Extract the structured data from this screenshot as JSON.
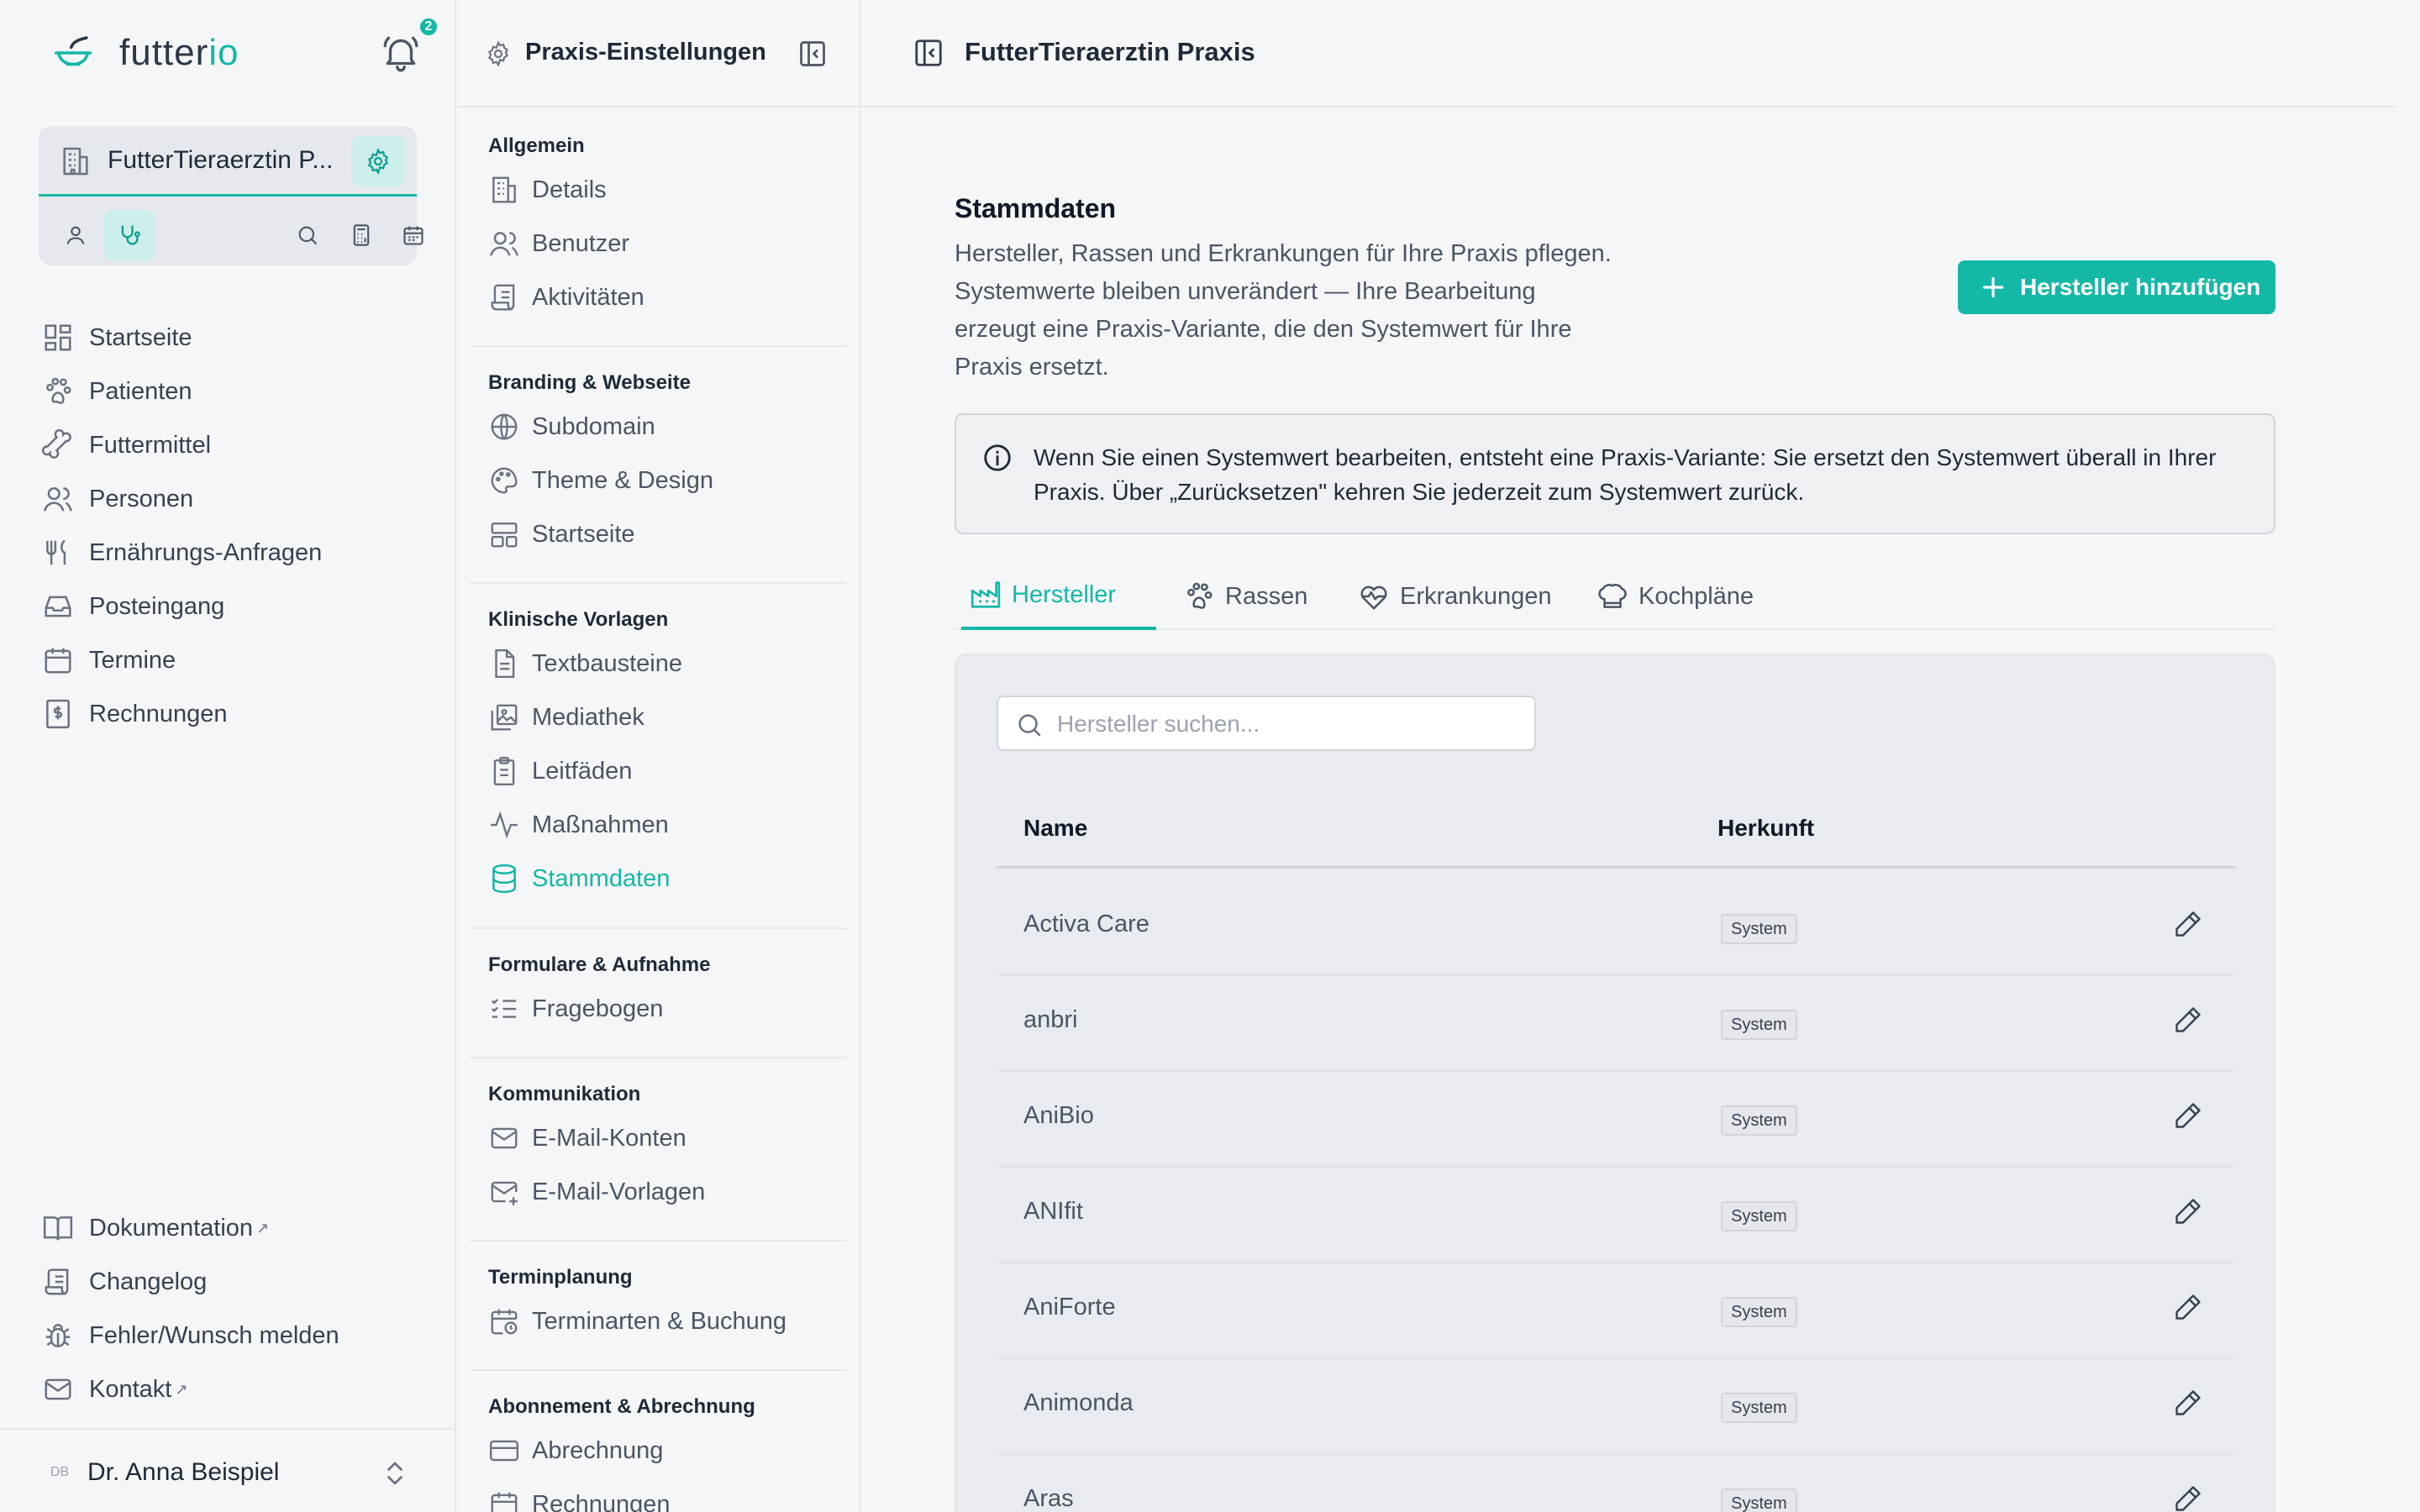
{
  "brand": {
    "logo_text_main": "futter",
    "logo_text_accent": "io",
    "notification_count": "2",
    "accent": "#14b8a6"
  },
  "practice": {
    "name": "FutterTieraerztin P..."
  },
  "nav": {
    "items": [
      {
        "label": "Startseite",
        "icon": "dashboard-icon"
      },
      {
        "label": "Patienten",
        "icon": "paw-icon"
      },
      {
        "label": "Futtermittel",
        "icon": "bone-icon"
      },
      {
        "label": "Personen",
        "icon": "users-icon"
      },
      {
        "label": "Ernährungs-Anfragen",
        "icon": "utensils-icon"
      },
      {
        "label": "Posteingang",
        "icon": "inbox-icon"
      },
      {
        "label": "Termine",
        "icon": "calendar-icon"
      },
      {
        "label": "Rechnungen",
        "icon": "invoice-icon"
      }
    ],
    "footer": [
      {
        "label": "Dokumentation",
        "icon": "book-icon",
        "external": "↗"
      },
      {
        "label": "Changelog",
        "icon": "scroll-icon",
        "external": ""
      },
      {
        "label": "Fehler/Wunsch melden",
        "icon": "bug-icon",
        "external": ""
      },
      {
        "label": "Kontakt",
        "icon": "mail-icon",
        "external": "↗"
      }
    ]
  },
  "user": {
    "initials": "DB",
    "name": "Dr. Anna Beispiel"
  },
  "settings": {
    "title": "Praxis-Einstellungen",
    "sections": [
      {
        "title": "Allgemein",
        "items": [
          "Details",
          "Benutzer",
          "Aktivitäten"
        ]
      },
      {
        "title": "Branding & Webseite",
        "items": [
          "Subdomain",
          "Theme & Design",
          "Startseite"
        ]
      },
      {
        "title": "Klinische Vorlagen",
        "items": [
          "Textbausteine",
          "Mediathek",
          "Leitfäden",
          "Maßnahmen",
          "Stammdaten"
        ]
      },
      {
        "title": "Formulare & Aufnahme",
        "items": [
          "Fragebogen"
        ]
      },
      {
        "title": "Kommunikation",
        "items": [
          "E-Mail-Konten",
          "E-Mail-Vorlagen"
        ]
      },
      {
        "title": "Terminplanung",
        "items": [
          "Terminarten & Buchung"
        ]
      },
      {
        "title": "Abonnement & Abrechnung",
        "items": [
          "Abrechnung",
          "Rechnungen"
        ]
      }
    ]
  },
  "main": {
    "title": "FutterTieraerztin Praxis",
    "section_title": "Stammdaten",
    "section_desc": "Hersteller, Rassen und Erkrankungen für Ihre Praxis pflegen. Systemwerte bleiben unverändert — Ihre Bearbeitung erzeugt eine Praxis-Variante, die den Systemwert für Ihre Praxis ersetzt.",
    "add_button": "Hersteller hinzufügen",
    "info": "Wenn Sie einen Systemwert bearbeiten, entsteht eine Praxis-Variante: Sie ersetzt den Systemwert überall in Ihrer Praxis. Über „Zurücksetzen\" kehren Sie jederzeit zum Systemwert zurück.",
    "tabs": [
      "Hersteller",
      "Rassen",
      "Erkrankungen",
      "Kochpläne"
    ],
    "search_placeholder": "Hersteller suchen...",
    "columns": [
      "Name",
      "Herkunft"
    ],
    "rows": [
      {
        "name": "Activa Care",
        "origin": "System"
      },
      {
        "name": "anbri",
        "origin": "System"
      },
      {
        "name": "AniBio",
        "origin": "System"
      },
      {
        "name": "ANIfit",
        "origin": "System"
      },
      {
        "name": "AniForte",
        "origin": "System"
      },
      {
        "name": "Animonda",
        "origin": "System"
      },
      {
        "name": "Aras",
        "origin": "System"
      }
    ]
  }
}
